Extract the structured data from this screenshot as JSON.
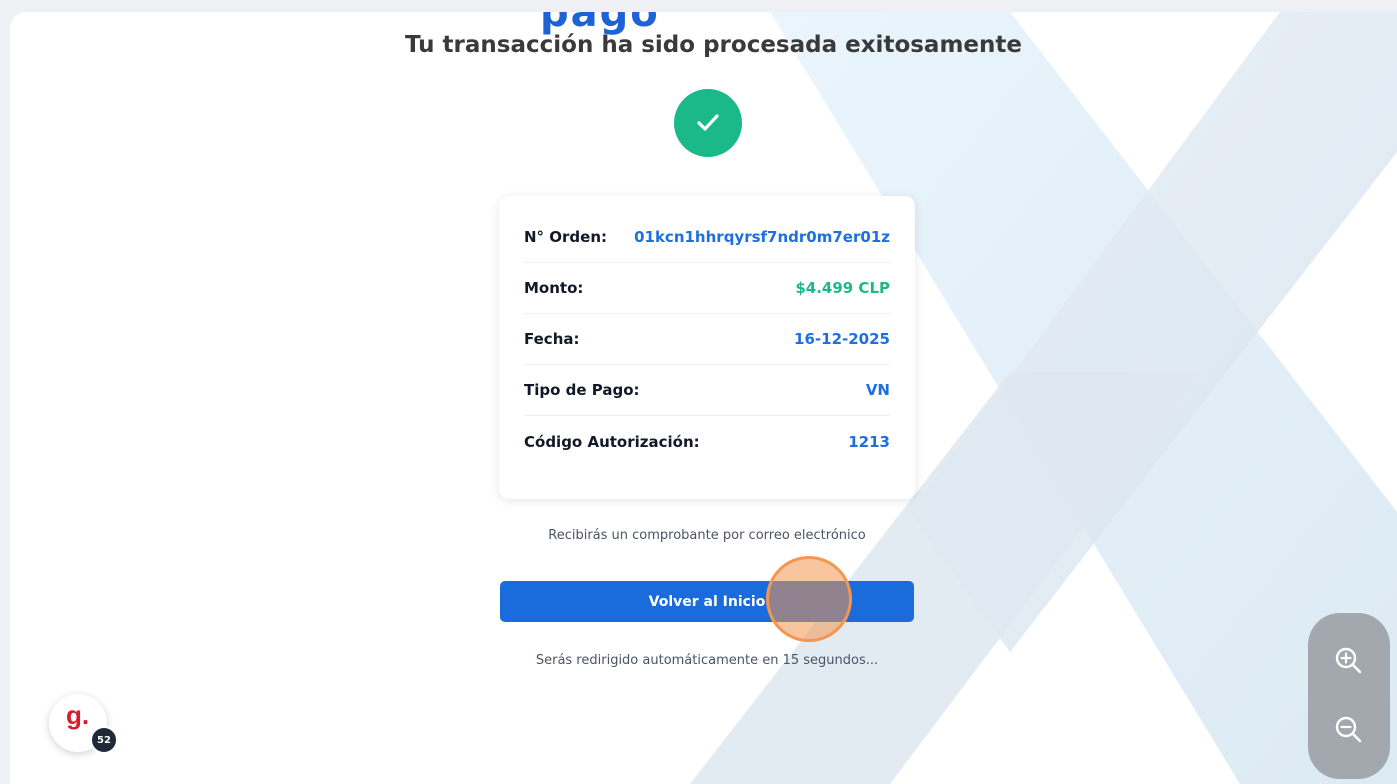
{
  "header": {
    "clipped_title": "pago",
    "subtitle": "Tu transacción ha sido procesada exitosamente"
  },
  "status": {
    "icon": "check-icon",
    "color": "#1bb98a"
  },
  "details": [
    {
      "label": "N° Orden:",
      "value": "01kcn1hhrqyrsf7ndr0m7er01z",
      "color": "#1e6fe0"
    },
    {
      "label": "Monto:",
      "value": "$4.499 CLP",
      "color": "#1bb98a"
    },
    {
      "label": "Fecha:",
      "value": "16-12-2025",
      "color": "#1e6fe0"
    },
    {
      "label": "Tipo de Pago:",
      "value": "VN",
      "color": "#1e6fe0"
    },
    {
      "label": "Código Autorización:",
      "value": "1213",
      "color": "#1e6fe0"
    }
  ],
  "email_note": "Recibirás un comprobante por correo electrónico",
  "primary_button": {
    "label": "Volver al Inicio",
    "color": "#1a6bdb"
  },
  "redirect_note": "Serás redirigido automáticamente en 15 segundos...",
  "zoom_controls": {
    "in_icon": "zoom-in-icon",
    "out_icon": "zoom-out-icon"
  },
  "brand_badge": {
    "logo": "g.",
    "count": "52",
    "logo_color": "#d41e2e"
  }
}
